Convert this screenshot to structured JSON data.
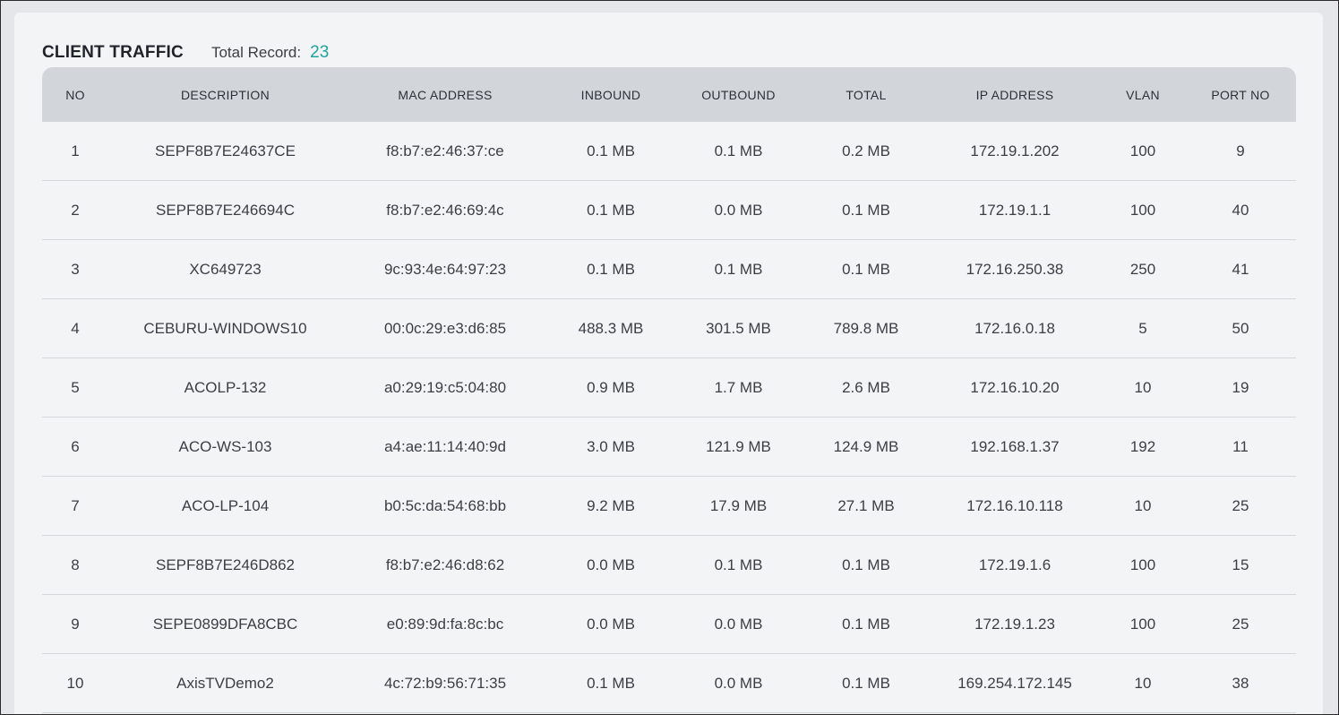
{
  "header": {
    "title": "CLIENT TRAFFIC",
    "total_label": "Total Record:",
    "total_value": "23"
  },
  "colors": {
    "accent": "#1fa3a0",
    "header_bg": "#d2d5da",
    "panel_bg": "#f3f4f5"
  },
  "table": {
    "columns": [
      "NO",
      "DESCRIPTION",
      "MAC ADDRESS",
      "INBOUND",
      "OUTBOUND",
      "TOTAL",
      "IP ADDRESS",
      "VLAN",
      "PORT NO"
    ],
    "rows": [
      [
        "1",
        "SEPF8B7E24637CE",
        "f8:b7:e2:46:37:ce",
        "0.1 MB",
        "0.1 MB",
        "0.2 MB",
        "172.19.1.202",
        "100",
        "9"
      ],
      [
        "2",
        "SEPF8B7E246694C",
        "f8:b7:e2:46:69:4c",
        "0.1 MB",
        "0.0 MB",
        "0.1 MB",
        "172.19.1.1",
        "100",
        "40"
      ],
      [
        "3",
        "XC649723",
        "9c:93:4e:64:97:23",
        "0.1 MB",
        "0.1 MB",
        "0.1 MB",
        "172.16.250.38",
        "250",
        "41"
      ],
      [
        "4",
        "CEBURU-WINDOWS10",
        "00:0c:29:e3:d6:85",
        "488.3 MB",
        "301.5 MB",
        "789.8 MB",
        "172.16.0.18",
        "5",
        "50"
      ],
      [
        "5",
        "ACOLP-132",
        "a0:29:19:c5:04:80",
        "0.9 MB",
        "1.7 MB",
        "2.6 MB",
        "172.16.10.20",
        "10",
        "19"
      ],
      [
        "6",
        "ACO-WS-103",
        "a4:ae:11:14:40:9d",
        "3.0 MB",
        "121.9 MB",
        "124.9 MB",
        "192.168.1.37",
        "192",
        "11"
      ],
      [
        "7",
        "ACO-LP-104",
        "b0:5c:da:54:68:bb",
        "9.2 MB",
        "17.9 MB",
        "27.1 MB",
        "172.16.10.118",
        "10",
        "25"
      ],
      [
        "8",
        "SEPF8B7E246D862",
        "f8:b7:e2:46:d8:62",
        "0.0 MB",
        "0.1 MB",
        "0.1 MB",
        "172.19.1.6",
        "100",
        "15"
      ],
      [
        "9",
        "SEPE0899DFA8CBC",
        "e0:89:9d:fa:8c:bc",
        "0.0 MB",
        "0.0 MB",
        "0.1 MB",
        "172.19.1.23",
        "100",
        "25"
      ],
      [
        "10",
        "AxisTVDemo2",
        "4c:72:b9:56:71:35",
        "0.1 MB",
        "0.0 MB",
        "0.1 MB",
        "169.254.172.145",
        "10",
        "38"
      ]
    ]
  }
}
